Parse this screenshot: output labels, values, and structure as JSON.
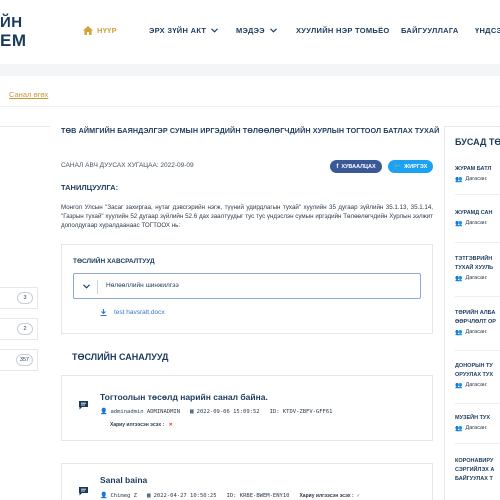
{
  "header": {
    "logo_line1": "ЙН",
    "logo_line2": "ЕМ",
    "nav": [
      {
        "label": "НҮҮР",
        "icon": "home-icon",
        "dropdown": false
      },
      {
        "label": "ЭРХ ЗҮЙН АКТ",
        "dropdown": true
      },
      {
        "label": "МЭДЭЭ",
        "dropdown": true
      },
      {
        "label": "ХУУЛИЙН НЭР ТОМЬЁО",
        "dropdown": false
      },
      {
        "label": "БАЙГУУЛЛАГА",
        "dropdown": false
      },
      {
        "label": "ҮНДСЭ",
        "dropdown": false
      }
    ]
  },
  "breadcrumb": "Санал өгөх",
  "left_sidebar": {
    "counts": [
      "3",
      "2",
      "357"
    ]
  },
  "main": {
    "title": "ТӨВ АЙМГИЙН БАЯНДЭЛГЭР СУМЫН ИРГЭДИЙН ТӨЛӨӨЛӨГЧДИЙН ХУРЛЫН ТОГТООЛ БАТЛАХ ТУХАЙ",
    "deadline": "САНАЛ АВЧ ДУУСАХ ХУГАЦАА: 2022-09-09",
    "share_facebook": "ХУВААЛЦАХ",
    "share_twitter": "ЖИРГЭХ",
    "intro_heading": "ТАНИЛЦУУЛГА:",
    "intro_text": "Монгол Улсын \"Засаг захиргаа, нутаг дэвсгэрийн нэгж, түүний удирдлагын тухай\" хуулийн 35 дугаар зүйлийн 35.1.13, 35.1.14, \"Газрын тухай\" хуулийн 52 дугаар зүйлийн 52.6 дах заалтуудыг тус тус үндэслэн сумын иргэдийн Төлөөлөгчдийн Хурлын ээлжит дополдугаар хуралдаанаас ТОГТООХ нь:",
    "draft": {
      "heading": "ТӨСЛИЙН ХАВСРАЛТУУД",
      "accordion_label": "Нөлөөллийн шинжилгээ",
      "file_name": "test havsralt.docx"
    },
    "comments_heading": "ТӨСЛИЙН САНАЛУУД",
    "comments": [
      {
        "title": "Тогтоолын төсөлд нарийн санал байна.",
        "author": "adminadmin ADMINADMIN",
        "date": "2022-09-06 15:09:52",
        "id": "ID: KTDV-ZBFV-GFF61",
        "status": "Хариу илгээсэн эсэх :",
        "status_mark": "✕"
      },
      {
        "title": "Sanal baina",
        "author": "Chimeg Z",
        "date": "2022-04-27 10:50:25",
        "id": "ID: KRBE-BWEM-ENY10",
        "status": "Хариу илгээсэн эсэх :",
        "status_mark": "✓"
      }
    ]
  },
  "right_sidebar": {
    "heading": "БУСАД ТӨ",
    "items": [
      {
        "title_lines": [
          "ЖУРАМ БАТЛ"
        ],
        "sub": "Дагасан:"
      },
      {
        "title_lines": [
          "ЖУРАМД САН"
        ],
        "sub": "Дагасан:"
      },
      {
        "title_lines": [
          "ТЭТГЭВРИЙН",
          "ТУХАЙ ХУУЛЬ"
        ],
        "sub": "Дагасан:"
      },
      {
        "title_lines": [
          "ТӨРИЙН АЛБА",
          "ӨӨРЧЛӨЛТ ОР"
        ],
        "sub": "Дагасан:"
      },
      {
        "title_lines": [
          "ДОНОРЫН ТУ",
          "ОРУУЛАХ ТУХ"
        ],
        "sub": "Дагасан:"
      },
      {
        "title_lines": [
          "МУЗЕЙН ТУХ"
        ],
        "sub": "Дагасан:"
      },
      {
        "title_lines": [
          "КОРОНАВИРУ",
          "СЭРГИЙЛЭХ А",
          "БАЙГУУЛАХ Т"
        ],
        "sub": ""
      }
    ]
  }
}
